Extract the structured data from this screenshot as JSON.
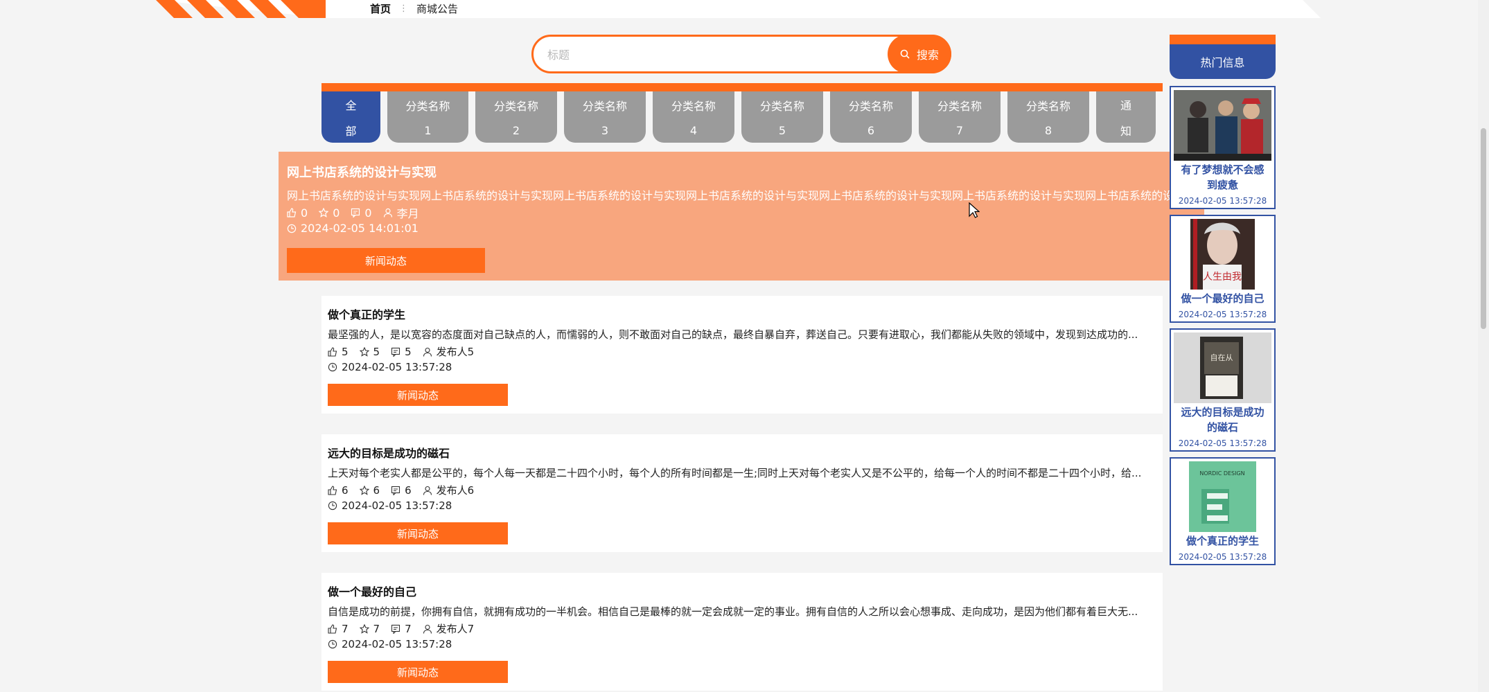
{
  "breadcrumb": {
    "home": "首页",
    "separator": "⋮",
    "current": "商城公告"
  },
  "search": {
    "placeholder": "标题",
    "button_label": "搜索"
  },
  "tabs": [
    {
      "line1": "全",
      "line2": "部",
      "active": true
    },
    {
      "line1": "分类名称",
      "line2": "1"
    },
    {
      "line1": "分类名称",
      "line2": "2"
    },
    {
      "line1": "分类名称",
      "line2": "3"
    },
    {
      "line1": "分类名称",
      "line2": "4"
    },
    {
      "line1": "分类名称",
      "line2": "5"
    },
    {
      "line1": "分类名称",
      "line2": "6"
    },
    {
      "line1": "分类名称",
      "line2": "7"
    },
    {
      "line1": "分类名称",
      "line2": "8"
    },
    {
      "line1": "通",
      "line2": "知"
    }
  ],
  "featured": {
    "title": "网上书店系统的设计与实现",
    "description": "网上书店系统的设计与实现网上书店系统的设计与实现网上书店系统的设计与实现网上书店系统的设计与实现网上书店系统的设计与实现网上书店系统的设计与实现网上书店系统的设计与实现网上书店系...",
    "likes": "0",
    "favorites": "0",
    "comments": "0",
    "author": "李月",
    "time": "2024-02-05 14:01:01",
    "category": "新闻动态"
  },
  "articles": [
    {
      "title": "做个真正的学生",
      "description": "最坚强的人，是以宽容的态度面对自己缺点的人，而懦弱的人，则不敢面对自己的缺点，最终自暴自弃，葬送自己。只要有进取心，我们都能从失败的领域中，发现到达成功的...",
      "likes": "5",
      "favorites": "5",
      "comments": "5",
      "author": "发布人5",
      "time": "2024-02-05 13:57:28",
      "category": "新闻动态"
    },
    {
      "title": "远大的目标是成功的磁石",
      "description": "上天对每个老实人都是公平的，每个人每一天都是二十四个小时，每个人的所有时间都是一生;同时上天对每个老实人又是不公平的，给每一个人的时间不都是二十四个小时，给...",
      "likes": "6",
      "favorites": "6",
      "comments": "6",
      "author": "发布人6",
      "time": "2024-02-05 13:57:28",
      "category": "新闻动态"
    },
    {
      "title": "做一个最好的自己",
      "description": "自信是成功的前提，你拥有自信，就拥有成功的一半机会。相信自己是最棒的就一定会成就一定的事业。拥有自信的人之所以会心想事成、走向成功，是因为他们都有着巨大无...",
      "likes": "7",
      "favorites": "7",
      "comments": "7",
      "author": "发布人7",
      "time": "2024-02-05 13:57:28",
      "category": "新闻动态"
    }
  ],
  "sidebar": {
    "heading": "热门信息",
    "items": [
      {
        "title_line1": "有了梦想就不会感",
        "title_line2": "到疲惫",
        "date": "2024-02-05 13:57:28",
        "thumb_text": ""
      },
      {
        "title_line1": "做一个最好的自己",
        "title_line2": "",
        "date": "2024-02-05 13:57:28",
        "thumb_text": "人生由我"
      },
      {
        "title_line1": "远大的目标是成功",
        "title_line2": "的磁石",
        "date": "2024-02-05 13:57:28",
        "thumb_text": "自在从"
      },
      {
        "title_line1": "做个真正的学生",
        "title_line2": "",
        "date": "2024-02-05 13:57:28",
        "thumb_text": "NORDIC DESIGN"
      }
    ]
  },
  "colors": {
    "accent": "#ff6a1a",
    "primary": "#3252a3",
    "tab_inactive": "#9b9b9b",
    "featured_bg": "#f89868"
  },
  "icons": {
    "like": "thumb-up-icon",
    "favorite": "star-icon",
    "comment": "comment-icon",
    "author": "user-icon",
    "time": "clock-icon",
    "search": "search-icon"
  }
}
